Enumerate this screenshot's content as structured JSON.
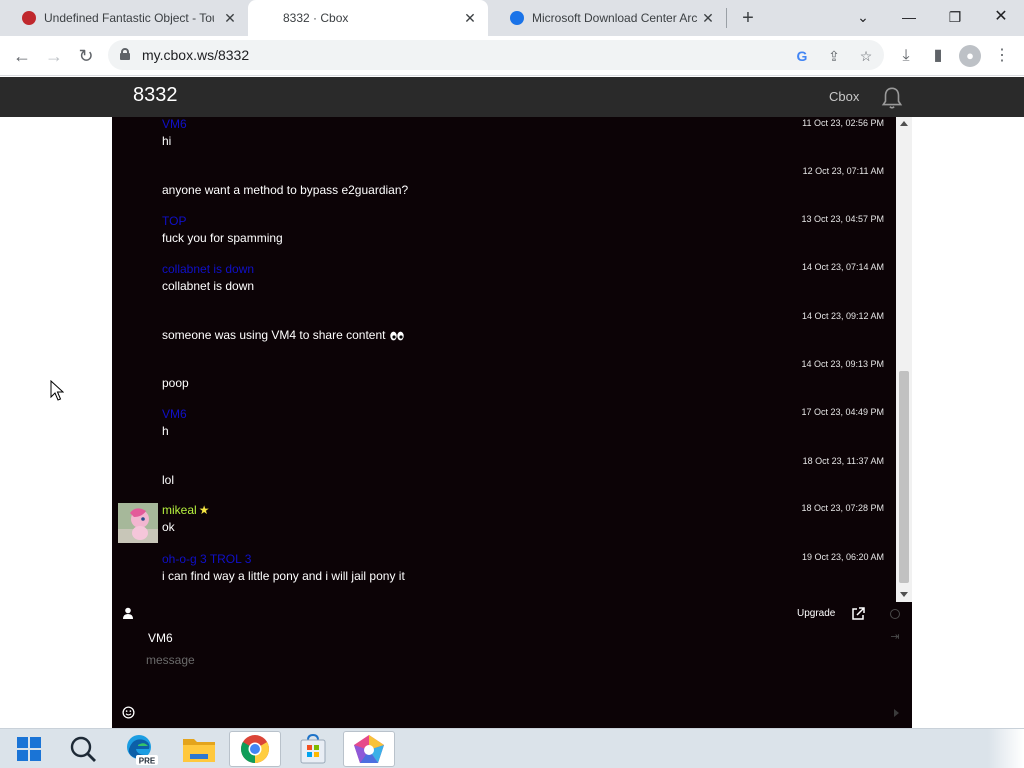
{
  "browser": {
    "tabs": [
      {
        "title": "Undefined Fantastic Object - Tou",
        "active": false,
        "favicon_color": "#c0282d"
      },
      {
        "title": "8332 · Cbox",
        "active": true,
        "favicon_color": ""
      },
      {
        "title": "Microsoft Download Center Arc",
        "active": false,
        "favicon_color": "#1a73e8"
      }
    ],
    "new_tab_icon": "plus-icon",
    "url": "my.cbox.ws/8332"
  },
  "cbox": {
    "room_title": "8332",
    "brand_link": "Cbox",
    "bell_icon": "bell-icon"
  },
  "messages": [
    {
      "name": "VM6",
      "time": "11 Oct 23, 02:56 PM",
      "text": "hi",
      "name_color": "#1010c8"
    },
    {
      "name": "",
      "time": "12 Oct 23, 07:11 AM",
      "text": "anyone want a method to bypass e2guardian?",
      "name_color": ""
    },
    {
      "name": "TOP",
      "time": "13 Oct 23, 04:57 PM",
      "text": "fuck you for spamming",
      "name_color": "#1010c8"
    },
    {
      "name": "collabnet is down",
      "time": "14 Oct 23, 07:14 AM",
      "text": "collabnet is down",
      "name_color": "#1010c8"
    },
    {
      "name": "",
      "time": "14 Oct 23, 09:12 AM",
      "text": "someone was using VM4 to share content",
      "name_color": "",
      "emoji": "eyes-icon"
    },
    {
      "name": "",
      "time": "14 Oct 23, 09:13 PM",
      "text": "poop",
      "name_color": ""
    },
    {
      "name": "VM6",
      "time": "17 Oct 23, 04:49 PM",
      "text": "h",
      "name_color": "#1010c8"
    },
    {
      "name": "",
      "time": "18 Oct 23, 11:37 AM",
      "text": "lol",
      "name_color": ""
    },
    {
      "name": "mikeal",
      "time": "18 Oct 23, 07:28 PM",
      "text": "ok",
      "name_color": "#b7f33f",
      "badge": "star-icon",
      "avatar": true
    },
    {
      "name": "oh-o-g 3 TROL 3",
      "time": "19 Oct 23, 06:20 AM",
      "text": "i can find way a little pony and i will jail pony it",
      "name_color": "#1010c8"
    }
  ],
  "compose": {
    "upgrade_label": "Upgrade",
    "nickname": "VM6",
    "placeholder": "message"
  },
  "taskbar": {
    "items": [
      "windows-start-icon",
      "search-icon",
      "edge-preview-icon",
      "file-explorer-icon",
      "chrome-icon",
      "microsoft-store-icon",
      "app-icon"
    ],
    "edge_badge": "PRE"
  }
}
